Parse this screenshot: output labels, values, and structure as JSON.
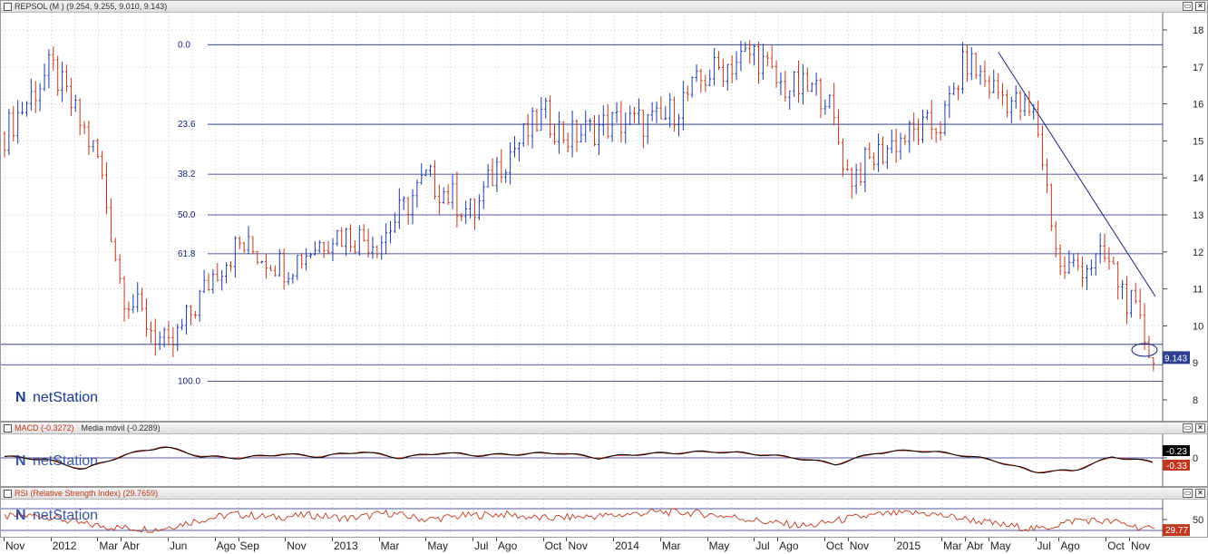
{
  "colors": {
    "up": "#1f3aa8",
    "down": "#c0391f",
    "grid": "#1a237e",
    "macd": "#000000",
    "signal": "#c0391f",
    "rsi": "#c0391f",
    "badge_price": "#2e3f8f",
    "badge_macd": "#000000",
    "badge_signal": "#c0391f",
    "badge_rsi": "#c0391f"
  },
  "icons": {
    "restore": "restore-icon",
    "close": "close-icon"
  },
  "watermark": {
    "text": "netStation",
    "logo": "N-logo-icon"
  },
  "price_panel": {
    "title": "REPSOL (M )",
    "ohlc": "(9.254, 9.255, 9.010, 9.143)",
    "last_price": "9.143",
    "y_ticks": [
      "8",
      "9",
      "10",
      "11",
      "12",
      "13",
      "14",
      "15",
      "16",
      "17",
      "18"
    ],
    "fib_labels": [
      "0.0",
      "23.6",
      "38.2",
      "50.0",
      "61.8",
      "100.0"
    ]
  },
  "macd_panel": {
    "title": "MACD (-0.3272)",
    "subtitle": "Media móvil (-0.2289)",
    "y_ticks": [
      "0"
    ],
    "badge_macd": "-0.23",
    "badge_signal": "-0.33"
  },
  "rsi_panel": {
    "title": "RSI (Relative Strength Index) (29.7659)",
    "y_ticks": [
      "50"
    ],
    "badge": "29.77"
  },
  "x_axis": [
    "Nov",
    "2012",
    "Mar",
    "Abr",
    "Jun",
    "Ago",
    "Sep",
    "Nov",
    "2013",
    "Mar",
    "May",
    "Jul",
    "Ago",
    "Oct",
    "Nov",
    "2014",
    "Mar",
    "May",
    "Jul",
    "Ago",
    "Oct",
    "Nov",
    "2015",
    "Mar",
    "Abr",
    "May",
    "Jul",
    "Ago",
    "Oct",
    "Nov"
  ],
  "chart_data": [
    {
      "type": "candlestick",
      "title": "REPSOL (M )",
      "x": [
        "2011-11",
        "2012-01",
        "2012-03",
        "2012-04",
        "2012-06",
        "2012-08",
        "2012-09",
        "2012-11",
        "2013-01",
        "2013-03",
        "2013-05",
        "2013-07",
        "2013-08",
        "2013-10",
        "2013-11",
        "2014-01",
        "2014-03",
        "2014-05",
        "2014-07",
        "2014-08",
        "2014-10",
        "2014-11",
        "2015-01",
        "2015-03",
        "2015-04",
        "2015-05",
        "2015-07",
        "2015-08",
        "2015-10",
        "2015-11",
        "2015-12"
      ],
      "close": [
        15.2,
        17.0,
        14.5,
        11.0,
        9.3,
        11.5,
        12.2,
        11.6,
        12.5,
        12.3,
        14.0,
        13.0,
        14.3,
        15.7,
        15.1,
        15.5,
        15.5,
        16.8,
        17.4,
        16.5,
        16.3,
        14.0,
        15.0,
        15.5,
        17.2,
        16.5,
        15.6,
        11.5,
        11.8,
        10.6,
        9.143
      ],
      "last_ohlc": {
        "open": 9.254,
        "high": 9.255,
        "low": 9.01,
        "close": 9.143
      },
      "ylim": [
        8,
        18
      ],
      "fibonacci": [
        {
          "level": "0.0",
          "price": 17.6
        },
        {
          "level": "23.6",
          "price": 15.45
        },
        {
          "level": "38.2",
          "price": 14.1
        },
        {
          "level": "50.0",
          "price": 13.0
        },
        {
          "level": "61.8",
          "price": 11.95
        },
        {
          "level": "100.0",
          "price": 8.5
        }
      ],
      "extra_levels": [
        9.5,
        8.95
      ],
      "trendline": {
        "from": {
          "x": "2015-05",
          "price": 17.4
        },
        "to": {
          "x": "2015-12",
          "price": 10.8
        }
      }
    },
    {
      "type": "line",
      "title": "MACD (-0.3272)",
      "series": [
        {
          "name": "MACD",
          "last": -0.3272
        },
        {
          "name": "Media móvil",
          "last": -0.2289
        }
      ],
      "values": [
        0.1,
        -0.1,
        -0.9,
        0.2,
        0.9,
        0.1,
        0.0,
        0.3,
        0.1,
        0.5,
        0.0,
        0.4,
        0.2,
        0.3,
        0.4,
        0.0,
        0.3,
        0.4,
        0.5,
        0.3,
        0.0,
        -0.5,
        0.4,
        0.6,
        0.3,
        -0.2,
        -1.1,
        -1.0,
        0.1,
        -0.33
      ]
    },
    {
      "type": "line",
      "title": "RSI (Relative Strength Index) (29.7659)",
      "series": [
        {
          "name": "RSI",
          "last": 29.7659
        }
      ],
      "values": [
        55,
        58,
        42,
        35,
        32,
        48,
        60,
        54,
        58,
        52,
        62,
        50,
        57,
        60,
        52,
        55,
        58,
        64,
        62,
        55,
        44,
        38,
        52,
        60,
        62,
        52,
        40,
        32,
        50,
        45,
        29.77
      ]
    }
  ]
}
